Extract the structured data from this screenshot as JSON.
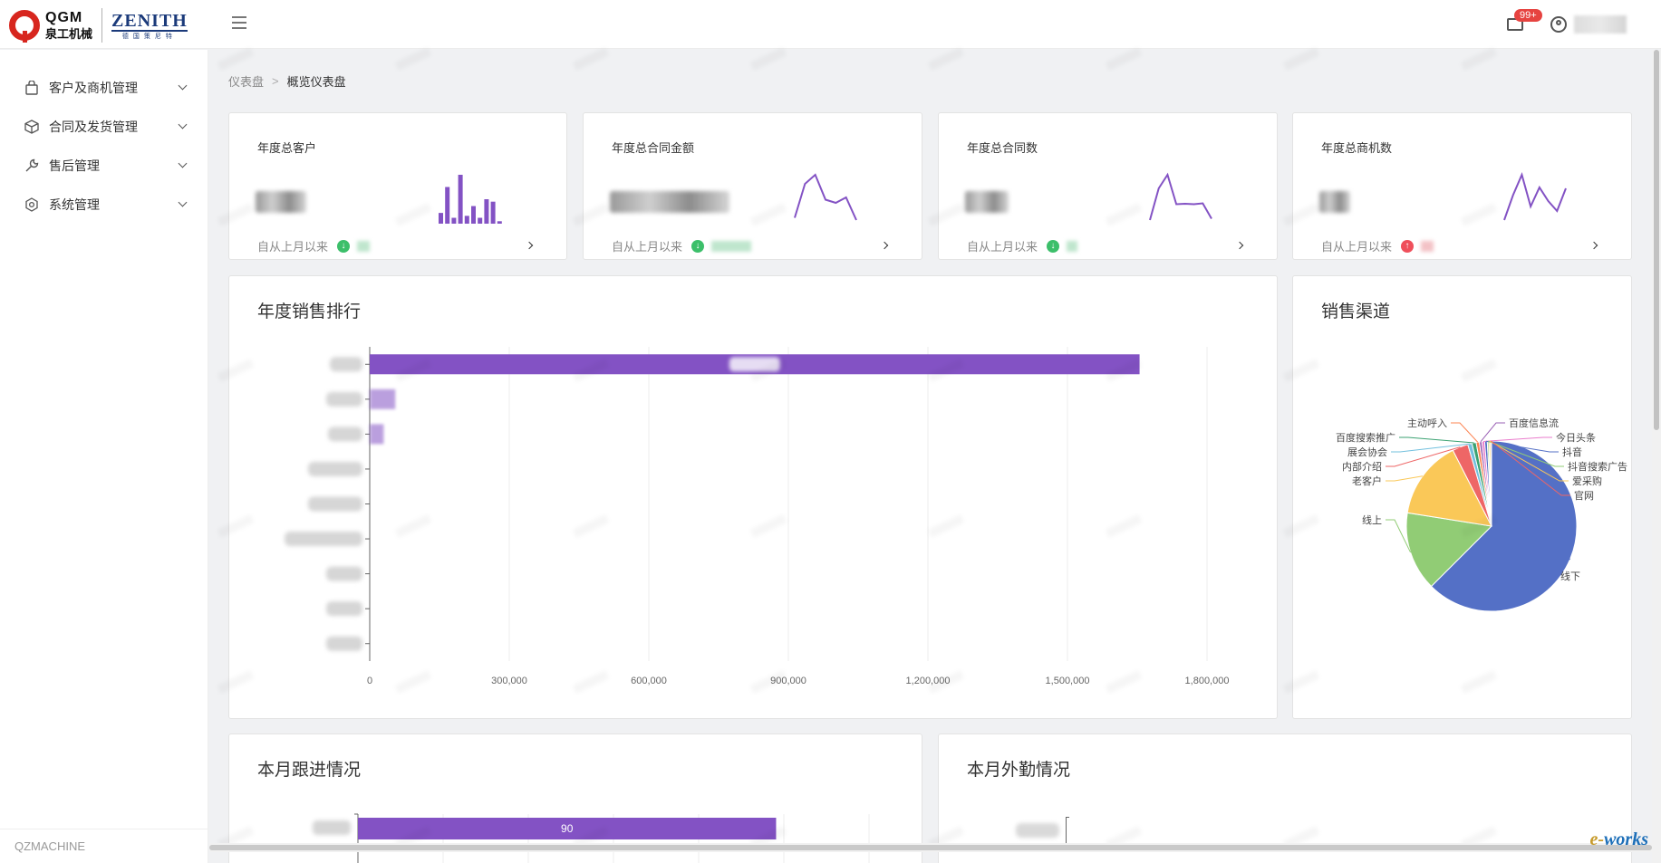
{
  "header": {
    "logo_line1": "QGM",
    "logo_line2": "泉工机械",
    "logo_zenith": "ZENITH",
    "logo_zenith_sub": "德国策尼特",
    "notification_badge": "99+"
  },
  "sidebar": {
    "items": [
      {
        "label": "客户及商机管理",
        "icon": "bag-icon"
      },
      {
        "label": "合同及发货管理",
        "icon": "box-icon"
      },
      {
        "label": "售后管理",
        "icon": "wrench-icon"
      },
      {
        "label": "系统管理",
        "icon": "settings-icon"
      }
    ],
    "footer": "QZMACHINE"
  },
  "breadcrumb": {
    "parent": "仪表盘",
    "current": "概览仪表盘"
  },
  "stats": [
    {
      "title": "年度总客户",
      "footer": "自从上月以来",
      "trend": "down",
      "spark": "bars",
      "bars": [
        0.22,
        0.75,
        0.12,
        1.0,
        0.16,
        0.36,
        0.12,
        0.5,
        0.45,
        0.05
      ]
    },
    {
      "title": "年度总合同金额",
      "footer": "自从上月以来",
      "trend": "down",
      "spark": "line",
      "points": [
        0.05,
        0.8,
        1.0,
        0.45,
        0.38,
        0.5,
        0.0
      ]
    },
    {
      "title": "年度总合同数",
      "footer": "自从上月以来",
      "trend": "down",
      "spark": "line",
      "points": [
        0.0,
        0.7,
        1.0,
        0.35,
        0.36,
        0.35,
        0.37,
        0.03
      ]
    },
    {
      "title": "年度总商机数",
      "footer": "自从上月以来",
      "trend": "up",
      "spark": "line",
      "points": [
        0.0,
        0.55,
        1.0,
        0.3,
        0.72,
        0.42,
        0.2,
        0.7
      ]
    }
  ],
  "panels": {
    "sales_rank": "年度销售排行",
    "sales_channel": "销售渠道",
    "monthly_followup": "本月跟进情况",
    "monthly_field": "本月外勤情况"
  },
  "colors": {
    "purple": "#8352c4",
    "accent_red": "#e64340"
  },
  "chart_data": [
    {
      "type": "bar",
      "orientation": "horizontal",
      "title": "年度销售排行",
      "categories": [
        "",
        "",
        "",
        "",
        "",
        "",
        "",
        "",
        ""
      ],
      "values": [
        1655000,
        55000,
        30000,
        0,
        0,
        0,
        0,
        0,
        0
      ],
      "xlim": [
        0,
        1800000
      ],
      "ticks": [
        "0",
        "300,000",
        "600,000",
        "900,000",
        "1,200,000",
        "1,500,000",
        "1,800,000"
      ],
      "grid": true
    },
    {
      "type": "pie",
      "title": "销售渠道",
      "slices": [
        {
          "name": "线下",
          "value": 62.5,
          "color": "#5470c6"
        },
        {
          "name": "线上",
          "value": 15.0,
          "color": "#91cc75"
        },
        {
          "name": "老客户",
          "value": 15.0,
          "color": "#fac858"
        },
        {
          "name": "内部介绍",
          "value": 3.0,
          "color": "#ee6666"
        },
        {
          "name": "展会协会",
          "value": 0.8,
          "color": "#73c0de"
        },
        {
          "name": "百度搜索推广",
          "value": 0.8,
          "color": "#3ba272"
        },
        {
          "name": "主动呼入",
          "value": 0.6,
          "color": "#fc8452"
        },
        {
          "name": "百度信息流",
          "value": 0.5,
          "color": "#9a60b4"
        },
        {
          "name": "今日头条",
          "value": 0.5,
          "color": "#ea7ccc"
        },
        {
          "name": "抖音",
          "value": 0.5,
          "color": "#5470c6"
        },
        {
          "name": "抖音搜索广告",
          "value": 0.3,
          "color": "#91cc75"
        },
        {
          "name": "爱采购",
          "value": 0.3,
          "color": "#fac858"
        },
        {
          "name": "官网",
          "value": 0.2,
          "color": "#ee6666"
        }
      ]
    },
    {
      "type": "bar",
      "orientation": "horizontal",
      "title": "本月跟进情况",
      "categories": [
        ""
      ],
      "values": [
        90
      ],
      "data_labels": [
        "90"
      ],
      "xlim": [
        0,
        110
      ]
    }
  ]
}
